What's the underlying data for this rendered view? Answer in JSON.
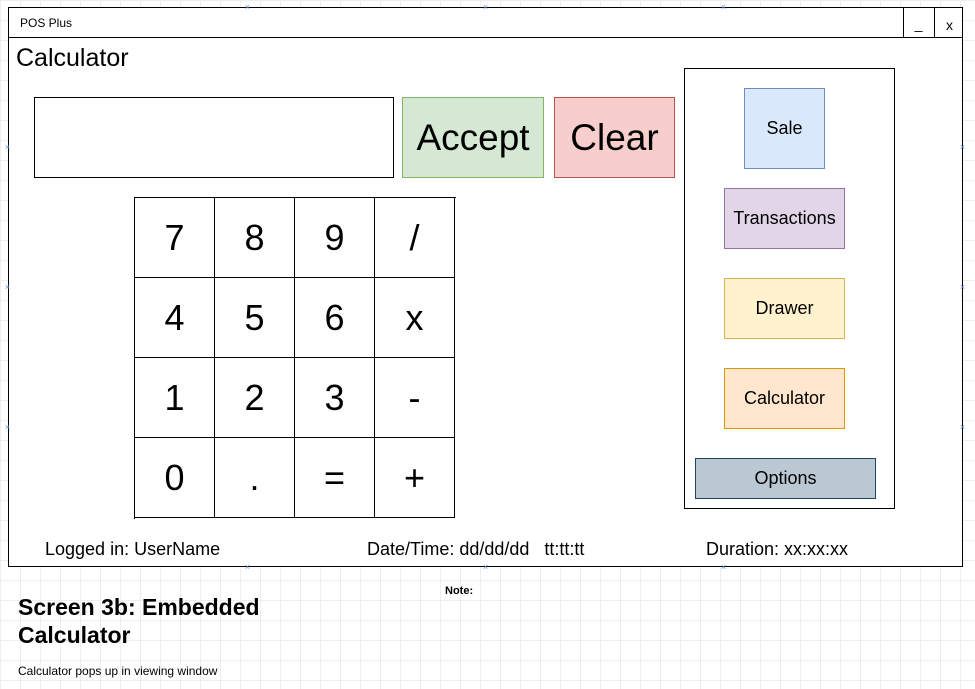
{
  "window": {
    "app_title": "POS Plus",
    "minimize_label": "_",
    "close_label": "x"
  },
  "page_title": "Calculator",
  "display": {
    "value": ""
  },
  "actions": {
    "accept_label": "Accept",
    "clear_label": "Clear"
  },
  "keypad": {
    "keys": [
      "7",
      "8",
      "9",
      "/",
      "4",
      "5",
      "6",
      "x",
      "1",
      "2",
      "3",
      "-",
      "0",
      ".",
      "=",
      "+"
    ]
  },
  "nav": {
    "sale": "Sale",
    "transactions": "Transactions",
    "drawer": "Drawer",
    "calculator": "Calculator",
    "options": "Options"
  },
  "status": {
    "logged_in": "Logged in: UserName",
    "datetime": "Date/Time: dd/dd/dd   tt:tt:tt",
    "duration": "Duration: xx:xx:xx"
  },
  "annotation": {
    "screen_title": "Screen 3b: Embedded Calculator",
    "caption": "Calculator pops up in viewing window",
    "note_label": "Note:"
  },
  "colors": {
    "accept": "#d5e8d4",
    "clear": "#f8cecc",
    "sale": "#dae8fc",
    "transactions": "#e1d5e7",
    "drawer": "#fff2cc",
    "calculator": "#ffe6cc",
    "options": "#bac8d3"
  }
}
